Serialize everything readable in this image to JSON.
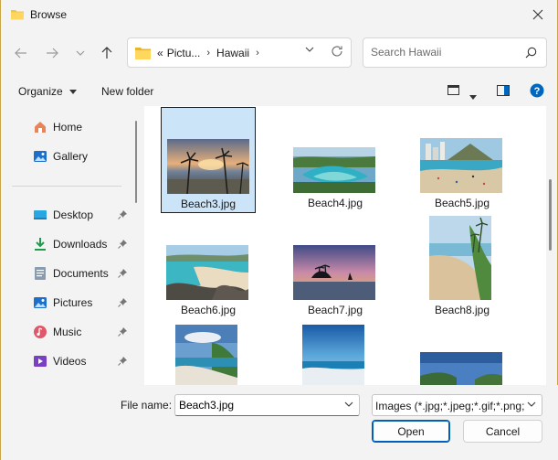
{
  "window": {
    "title": "Browse"
  },
  "nav": {
    "breadcrumb_overflow": "«",
    "breadcrumbs": [
      "Pictu...",
      "Hawaii"
    ],
    "search_placeholder": "Search Hawaii"
  },
  "toolbar": {
    "organize_label": "Organize",
    "new_folder_label": "New folder"
  },
  "sidebar": {
    "items": [
      {
        "label": "Home",
        "icon": "home-icon",
        "pinned": false
      },
      {
        "label": "Gallery",
        "icon": "gallery-icon",
        "pinned": false
      },
      {
        "label": "Desktop",
        "icon": "desktop-icon",
        "pinned": true
      },
      {
        "label": "Downloads",
        "icon": "downloads-icon",
        "pinned": true
      },
      {
        "label": "Documents",
        "icon": "documents-icon",
        "pinned": true
      },
      {
        "label": "Pictures",
        "icon": "pictures-icon",
        "pinned": true
      },
      {
        "label": "Music",
        "icon": "music-icon",
        "pinned": true
      },
      {
        "label": "Videos",
        "icon": "videos-icon",
        "pinned": true
      }
    ]
  },
  "files": [
    {
      "name": "Beach3.jpg",
      "selected": true
    },
    {
      "name": "Beach4.jpg",
      "selected": false
    },
    {
      "name": "Beach5.jpg",
      "selected": false
    },
    {
      "name": "Beach6.jpg",
      "selected": false
    },
    {
      "name": "Beach7.jpg",
      "selected": false
    },
    {
      "name": "Beach8.jpg",
      "selected": false
    },
    {
      "name": "",
      "selected": false
    },
    {
      "name": "",
      "selected": false
    },
    {
      "name": "",
      "selected": false
    }
  ],
  "footer": {
    "file_name_label": "File name:",
    "file_name_value": "Beach3.jpg",
    "filter_value": "Images (*.jpg;*.jpeg;*.gif;*.png;",
    "open_label": "Open",
    "cancel_label": "Cancel"
  },
  "colors": {
    "accent": "#005fb8",
    "selection": "#cce4f7",
    "folder": "#f4c542",
    "help": "#0067c0"
  }
}
